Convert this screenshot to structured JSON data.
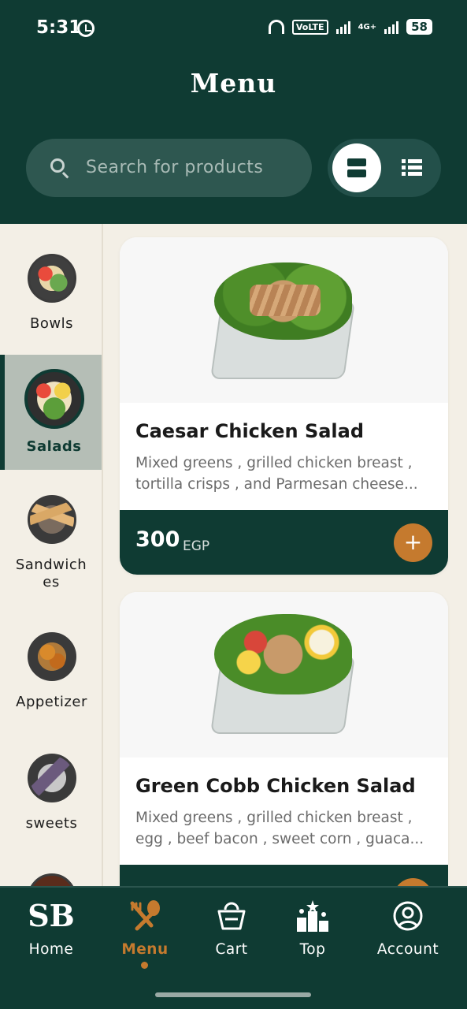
{
  "status_bar": {
    "time": "5:31",
    "volte": "VoLTE",
    "network": "4G+",
    "battery": "58"
  },
  "header": {
    "title": "Menu",
    "search_placeholder": "Search for products"
  },
  "categories": [
    {
      "label": "Bowls",
      "active": false,
      "icon": "bowl-thumbnail"
    },
    {
      "label": "Salads",
      "active": true,
      "icon": "salad-thumbnail"
    },
    {
      "label": "Sandwiches",
      "active": false,
      "icon": "sandwich-thumbnail"
    },
    {
      "label": "Appetizer",
      "active": false,
      "icon": "appetizer-thumbnail"
    },
    {
      "label": "sweets",
      "active": false,
      "icon": "sweets-thumbnail"
    }
  ],
  "products": [
    {
      "name": "Caesar Chicken Salad",
      "description": "Mixed greens , grilled chicken breast , tortilla crisps , and Parmesan cheese...",
      "price": "300",
      "currency": "EGP"
    },
    {
      "name": "Green Cobb Chicken Salad",
      "description": "Mixed greens , grilled chicken breast , egg , beef bacon , sweet corn , guaca..."
    }
  ],
  "tabs": [
    {
      "label": "Home",
      "icon": "sb-logo-icon"
    },
    {
      "label": "Menu",
      "icon": "fork-spoon-icon"
    },
    {
      "label": "Cart",
      "icon": "basket-icon"
    },
    {
      "label": "Top",
      "icon": "podium-stars-icon"
    },
    {
      "label": "Account",
      "icon": "user-circle-icon"
    }
  ],
  "colors": {
    "primary": "#0f3b33",
    "accent": "#c57a2e",
    "background": "#f3efe6",
    "active_category": "#b5beb6"
  }
}
